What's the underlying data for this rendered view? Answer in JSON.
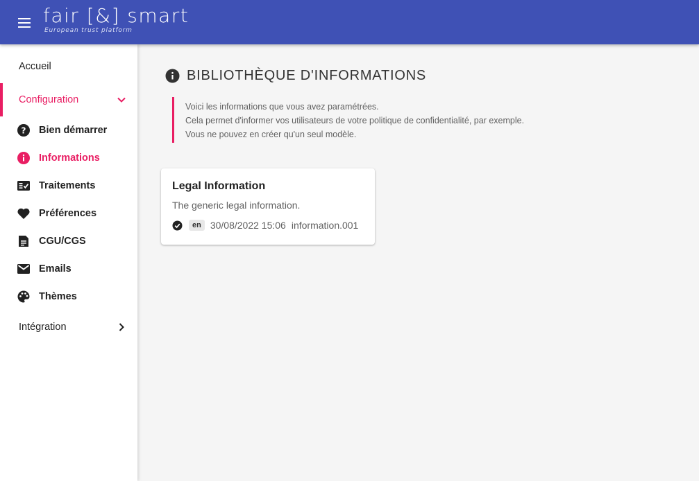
{
  "header": {
    "logo_text": "fair [&] smart",
    "logo_tagline": "European trust platform",
    "brand_color": "#3f51b5"
  },
  "sidebar": {
    "home": "Accueil",
    "configuration": "Configuration",
    "integration": "Intégration",
    "items": [
      {
        "label": "Bien démarrer",
        "icon": "help-circle-icon"
      },
      {
        "label": "Informations",
        "icon": "info-circle-icon"
      },
      {
        "label": "Traitements",
        "icon": "checklist-icon"
      },
      {
        "label": "Préférences",
        "icon": "heart-icon"
      },
      {
        "label": "CGU/CGS",
        "icon": "document-icon"
      },
      {
        "label": "Emails",
        "icon": "mail-icon"
      },
      {
        "label": "Thèmes",
        "icon": "palette-icon"
      }
    ],
    "active_item": "Informations",
    "accent_color": "#e91e63"
  },
  "page": {
    "title": "BIBLIOTHÈQUE D'INFORMATIONS",
    "note_lines": [
      "Voici les informations que vous avez paramétrées.",
      "Cela permet d'informer vos utilisateurs de votre politique de confidentialité, par exemple.",
      "Vous ne pouvez en créer qu'un seul modèle."
    ]
  },
  "cards": [
    {
      "title": "Legal Information",
      "description": "The generic legal information.",
      "language": "en",
      "date": "30/08/2022 15:06",
      "identifier": "information.001",
      "status_icon": "check-circle-icon"
    }
  ]
}
